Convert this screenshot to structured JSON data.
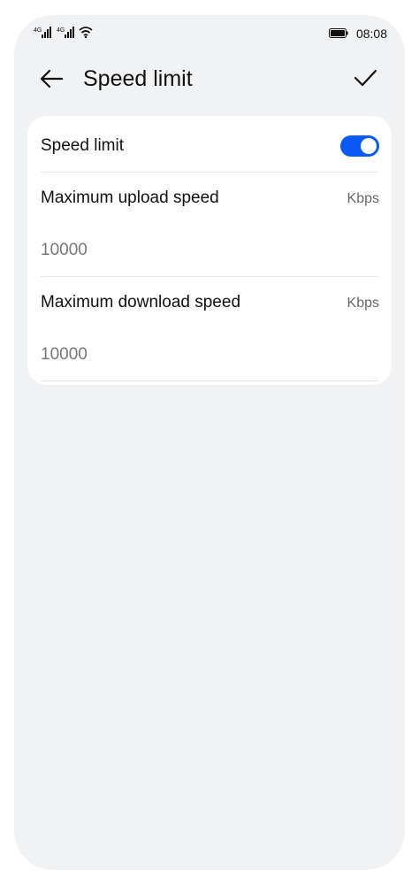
{
  "status_bar": {
    "signal_1": "signal-icon",
    "signal_2": "signal-icon",
    "wifi": "wifi-icon",
    "battery": "battery-icon",
    "time": "08:08"
  },
  "header": {
    "title": "Speed limit",
    "back_icon": "back-arrow-icon",
    "confirm_icon": "check-icon"
  },
  "settings": {
    "speed_limit_label": "Speed limit",
    "speed_limit_enabled": true,
    "upload_label": "Maximum upload speed",
    "upload_unit": "Kbps",
    "upload_value": "10000",
    "download_label": "Maximum download speed",
    "download_unit": "Kbps",
    "download_value": "10000"
  },
  "colors": {
    "accent": "#0a59f7",
    "background": "#f1f2f4",
    "card": "#ffffff"
  }
}
